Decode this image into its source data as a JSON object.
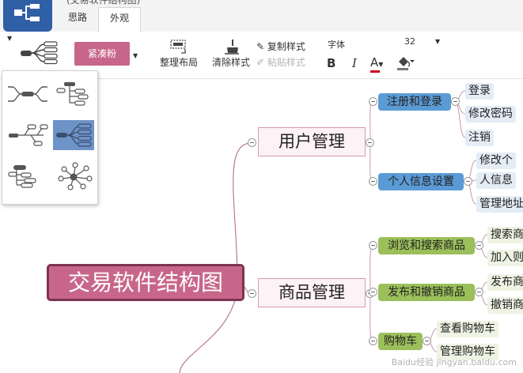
{
  "window": {
    "title": "(交易软件结构图)"
  },
  "tabs": [
    {
      "label": "思路"
    },
    {
      "label": "外观"
    }
  ],
  "toolbar": {
    "theme_label": "紧凑粉",
    "tidy_layout": "整理布局",
    "clear_style": "清除样式",
    "copy_style": "复制样式",
    "paste_style": "粘贴样式",
    "font_label": "字体",
    "font_size": "32",
    "bold": "B",
    "italic": "I",
    "font_color": "A",
    "font_color_hex": "#d0021b"
  },
  "mindmap": {
    "central": "交易软件结构图",
    "main_topics": [
      {
        "label": "用户管理",
        "subtopics": [
          {
            "label": "注册和登录",
            "leaves": [
              "登录",
              "修改密码",
              "注销"
            ]
          },
          {
            "label": "个人信息设置",
            "leaves": [
              "修改个",
              "人信息",
              "管理地址"
            ]
          }
        ]
      },
      {
        "label": "商品管理",
        "subtopics": [
          {
            "label": "浏览和搜索商品",
            "leaves": [
              "搜索商",
              "加入则"
            ]
          },
          {
            "label": "发布和撤销商品",
            "leaves": [
              "发布商",
              "撤销商"
            ]
          },
          {
            "label": "购物车",
            "leaves": [
              "查看购物车",
              "管理购物车"
            ]
          }
        ]
      }
    ]
  },
  "watermark": "Baidu经验 jingyan.baidu.com",
  "colors": {
    "accent_pink": "#c8668a",
    "subtopic_blue": "#5b9bd5",
    "subtopic_green": "#9bbf5a",
    "selected_structure": "#6e93c7"
  }
}
